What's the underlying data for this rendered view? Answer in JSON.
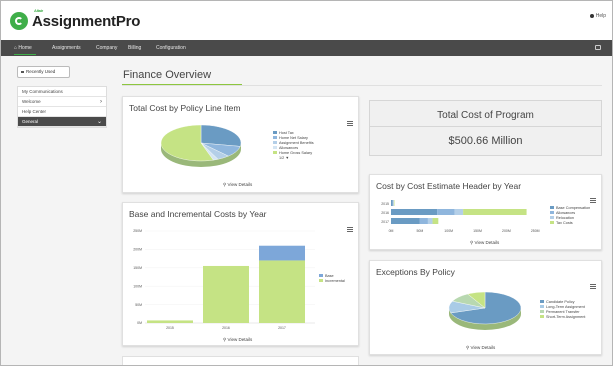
{
  "header": {
    "logo_sup": "Altair",
    "logo_text": "AssignmentPro",
    "help_label": "Help"
  },
  "nav": {
    "items": [
      "Home",
      "Assignments",
      "Company",
      "Billing",
      "Configuration"
    ]
  },
  "sidebar": {
    "recent_label": "Recently Used",
    "items": [
      "My Communications",
      "Welcome",
      "Help Center",
      "General"
    ]
  },
  "page": {
    "title": "Finance Overview"
  },
  "cards": {
    "policy_line": {
      "title": "Total Cost by Policy Line Item",
      "view_details": "View Details",
      "legend": [
        "Host Tax",
        "Home Net Salary",
        "Assignment Benefits",
        "Allowances",
        "Home Gross Salary"
      ],
      "legend_more": "1/2 ▼"
    },
    "total": {
      "title": "Total Cost of Program",
      "value": "$500.66 Million"
    },
    "estimate_header": {
      "title": "Cost by Cost Estimate Header by Year",
      "view_details": "View Details",
      "legend": [
        "Base Compensation",
        "Allowances",
        "Relocation",
        "Tax Costs"
      ]
    },
    "base_incremental": {
      "title": "Base and Incremental Costs by Year",
      "view_details": "View Details",
      "legend": [
        "Base",
        "Incremental"
      ]
    },
    "exceptions": {
      "title": "Exceptions By Policy",
      "view_details": "View Details",
      "legend": [
        "Candidate Policy",
        "Long-Term Assignment",
        "Permanent Transfer",
        "Short-Term Assignment"
      ]
    }
  },
  "colors": {
    "brand_green": "#3fae49",
    "nav_bg": "#4a4a4a",
    "series_blue": "#7da7d9",
    "series_green": "#c5e384",
    "series_teal": "#6a9bc3",
    "series_light": "#b8d8b0"
  },
  "chart_data": [
    {
      "type": "pie",
      "title": "Total Cost by Policy Line Item",
      "categories": [
        "Host Tax",
        "Home Net Salary",
        "Assignment Benefits",
        "Allowances",
        "Home Gross Salary"
      ],
      "values": [
        28,
        10,
        5,
        2,
        55
      ]
    },
    {
      "type": "bar",
      "title": "Cost by Cost Estimate Header by Year",
      "orientation": "horizontal",
      "categories": [
        "2015",
        "2016",
        "2017"
      ],
      "x_ticks": [
        "0M",
        "50M",
        "100M",
        "150M",
        "200M",
        "250M"
      ],
      "xlim": [
        0,
        260
      ],
      "series": [
        {
          "name": "Base Compensation",
          "values": [
            3,
            80,
            50
          ]
        },
        {
          "name": "Allowances",
          "values": [
            1,
            30,
            14
          ]
        },
        {
          "name": "Relocation",
          "values": [
            1,
            15,
            8
          ]
        },
        {
          "name": "Tax Costs",
          "values": [
            1,
            110,
            10
          ]
        }
      ]
    },
    {
      "type": "bar",
      "title": "Base and Incremental Costs by Year",
      "stacked": true,
      "categories": [
        "2015",
        "2016",
        "2017"
      ],
      "y_ticks": [
        "0M",
        "50M",
        "100M",
        "150M",
        "200M",
        "250M"
      ],
      "ylim": [
        0,
        250
      ],
      "series": [
        {
          "name": "Base",
          "values": [
            0,
            0,
            40
          ]
        },
        {
          "name": "Incremental",
          "values": [
            7,
            155,
            170
          ]
        }
      ]
    },
    {
      "type": "pie",
      "title": "Exceptions By Policy",
      "categories": [
        "Candidate Policy",
        "Long-Term Assignment",
        "Permanent Transfer",
        "Short-Term Assignment"
      ],
      "values": [
        70,
        12,
        10,
        8
      ]
    }
  ]
}
